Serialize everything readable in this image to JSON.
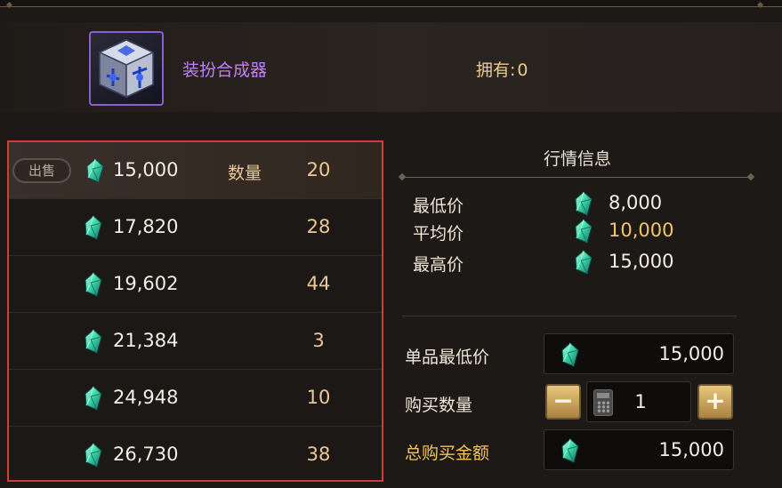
{
  "item": {
    "name": "装扮合成器",
    "owned_label": "拥有:",
    "owned_value": "0",
    "icon": "synthesizer-cube-icon"
  },
  "listings": {
    "sell_badge": "出售",
    "qty_label": "数量",
    "rows": [
      {
        "price": "15,000",
        "qty": "20"
      },
      {
        "price": "17,820",
        "qty": "28"
      },
      {
        "price": "19,602",
        "qty": "44"
      },
      {
        "price": "21,384",
        "qty": "3"
      },
      {
        "price": "24,948",
        "qty": "10"
      },
      {
        "price": "26,730",
        "qty": "38"
      }
    ]
  },
  "market": {
    "title": "行情信息",
    "min_label": "最低价",
    "min_value": "8,000",
    "avg_label": "平均价",
    "avg_value": "10,000",
    "max_label": "最高价",
    "max_value": "15,000"
  },
  "purchase": {
    "unit_price_label": "单品最低价",
    "unit_price_value": "15,000",
    "qty_label": "购买数量",
    "qty_value": "1",
    "minus": "−",
    "plus": "+",
    "total_label": "总购买金额",
    "total_value": "15,000"
  },
  "colors": {
    "accent_purple": "#c27fff",
    "gold": "#f3c35a",
    "highlight_border": "#d33a3a",
    "gem": "#39d3a6"
  }
}
